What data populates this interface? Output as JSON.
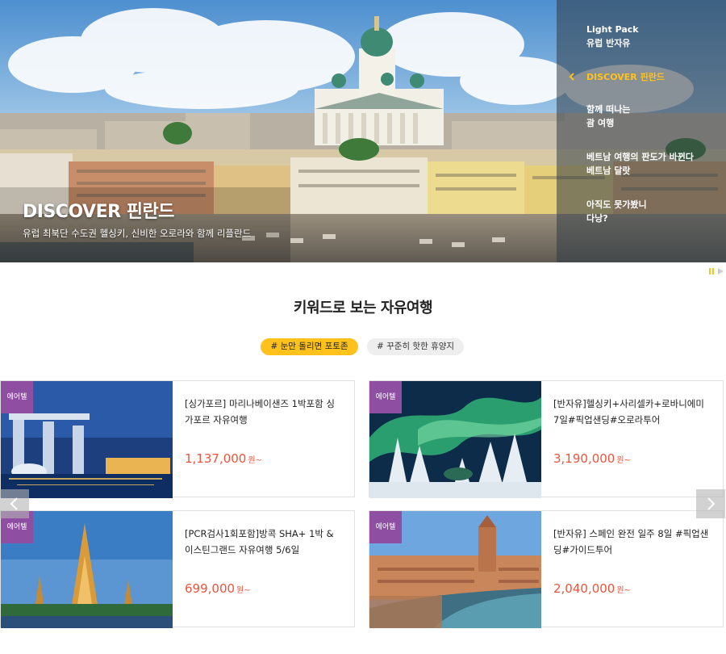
{
  "hero": {
    "title": "DISCOVER 핀란드",
    "subtitle": "유럽 최북단 수도권 헬싱키, 신비한 오로라와 함께 리플란드"
  },
  "side_nav": [
    {
      "label": "Light Pack\n유럽 반자유",
      "active": false
    },
    {
      "label": "DISCOVER 핀란드",
      "active": true
    },
    {
      "label": "함께 떠나는\n괌 여행",
      "active": false
    },
    {
      "label": "베트남 여행의 판도가 바뀐다\n베트남 달랏",
      "active": false
    },
    {
      "label": "아직도 못가봤니\n다낭?",
      "active": false
    }
  ],
  "section": {
    "title": "키워드로 보는 자유여행",
    "tags": [
      "# 눈만 돌리면 포토존",
      "# 꾸준히 핫한 휴양지"
    ]
  },
  "products": [
    {
      "badge": "에어텔",
      "name": "[싱가포르] 마리나베이샌즈 1박포함 싱가포르 자유여행",
      "price": "1,137,000",
      "unit": "원~",
      "image": "singapore-marina-bay"
    },
    {
      "badge": "에어텔",
      "name": "[반자유]헬싱키+사리셀카+로바니에미 7일#픽업샌딩#오로라투어",
      "price": "3,190,000",
      "unit": "원~",
      "image": "aurora-snow-forest"
    },
    {
      "badge": "에어텔",
      "name": "[PCR검사1회포함]방콕 SHA+ 1박 & 이스틴그랜드 자유여행 5/6일",
      "price": "699,000",
      "unit": "원~",
      "image": "bangkok-temple"
    },
    {
      "badge": "에어텔",
      "name": "[반자유] 스페인 완전 일주 8일 #픽업샌딩#가이드투어",
      "price": "2,040,000",
      "unit": "원~",
      "image": "seville-plaza"
    }
  ],
  "colors": {
    "accent": "#ffc21c",
    "price": "#f0533b",
    "badge": "#8e4fa3"
  }
}
